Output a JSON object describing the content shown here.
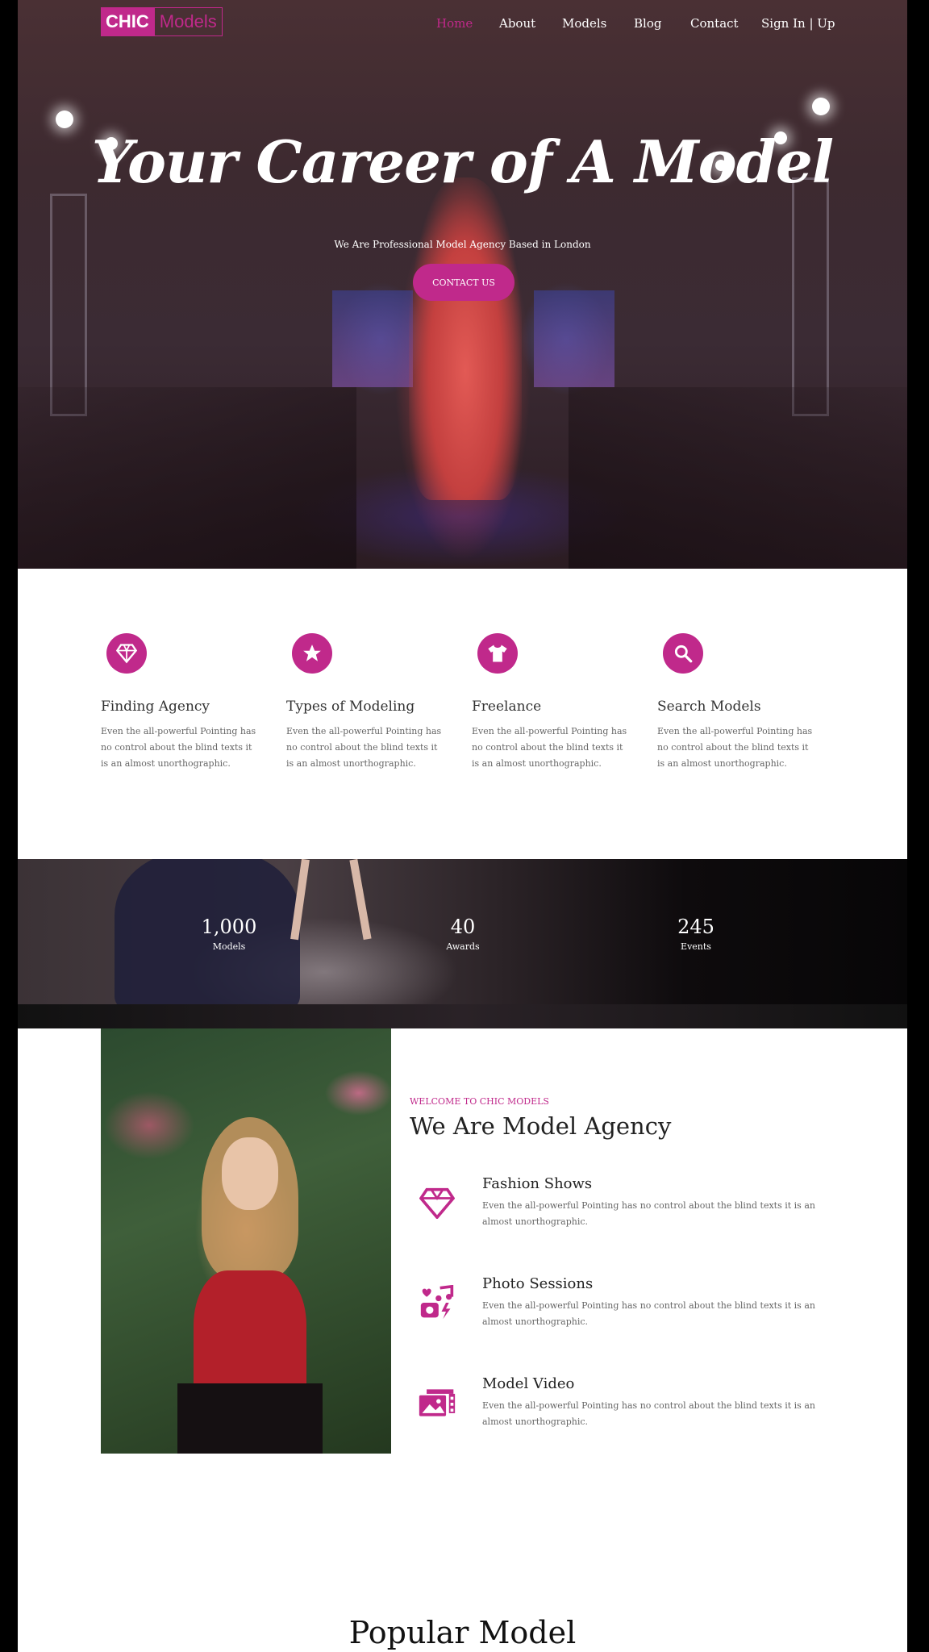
{
  "brand": {
    "logo_part1": "CHIC",
    "logo_part2": "Models",
    "accent": "#c0298b"
  },
  "nav": {
    "items": [
      "Home",
      "About",
      "Models",
      "Blog",
      "Contact",
      "Sign In | Up"
    ],
    "active": "Home"
  },
  "hero": {
    "title": "Your Career of A Model",
    "subtitle": "We Are Professional Model Agency Based in London",
    "button": "CONTACT US"
  },
  "features": [
    {
      "icon": "diamond-icon",
      "title": "Finding Agency",
      "text": "Even the all-powerful Pointing has no control about the blind texts it is an almost unorthographic."
    },
    {
      "icon": "star-icon",
      "title": "Types of Modeling",
      "text": "Even the all-powerful Pointing has no control about the blind texts it is an almost unorthographic."
    },
    {
      "icon": "tshirt-icon",
      "title": "Freelance",
      "text": "Even the all-powerful Pointing has no control about the blind texts it is an almost unorthographic."
    },
    {
      "icon": "search-icon",
      "title": "Search Models",
      "text": "Even the all-powerful Pointing has no control about the blind texts it is an almost unorthographic."
    }
  ],
  "stats": [
    {
      "number": "1,000",
      "label": "Models"
    },
    {
      "number": "40",
      "label": "Awards"
    },
    {
      "number": "245",
      "label": "Events"
    }
  ],
  "about": {
    "eyebrow": "WELCOME TO CHIC MODELS",
    "title": "We Are Model Agency",
    "services": [
      {
        "icon": "diamond-icon",
        "title": "Fashion Shows",
        "text": "Even the all-powerful Pointing has no control about the blind texts it is an almost unorthographic."
      },
      {
        "icon": "photo-music-icon",
        "title": "Photo Sessions",
        "text": "Even the all-powerful Pointing has no control about the blind texts it is an almost unorthographic."
      },
      {
        "icon": "video-gallery-icon",
        "title": "Model Video",
        "text": "Even the all-powerful Pointing has no control about the blind texts it is an almost unorthographic."
      }
    ]
  },
  "popular": {
    "title": "Popular Model"
  }
}
